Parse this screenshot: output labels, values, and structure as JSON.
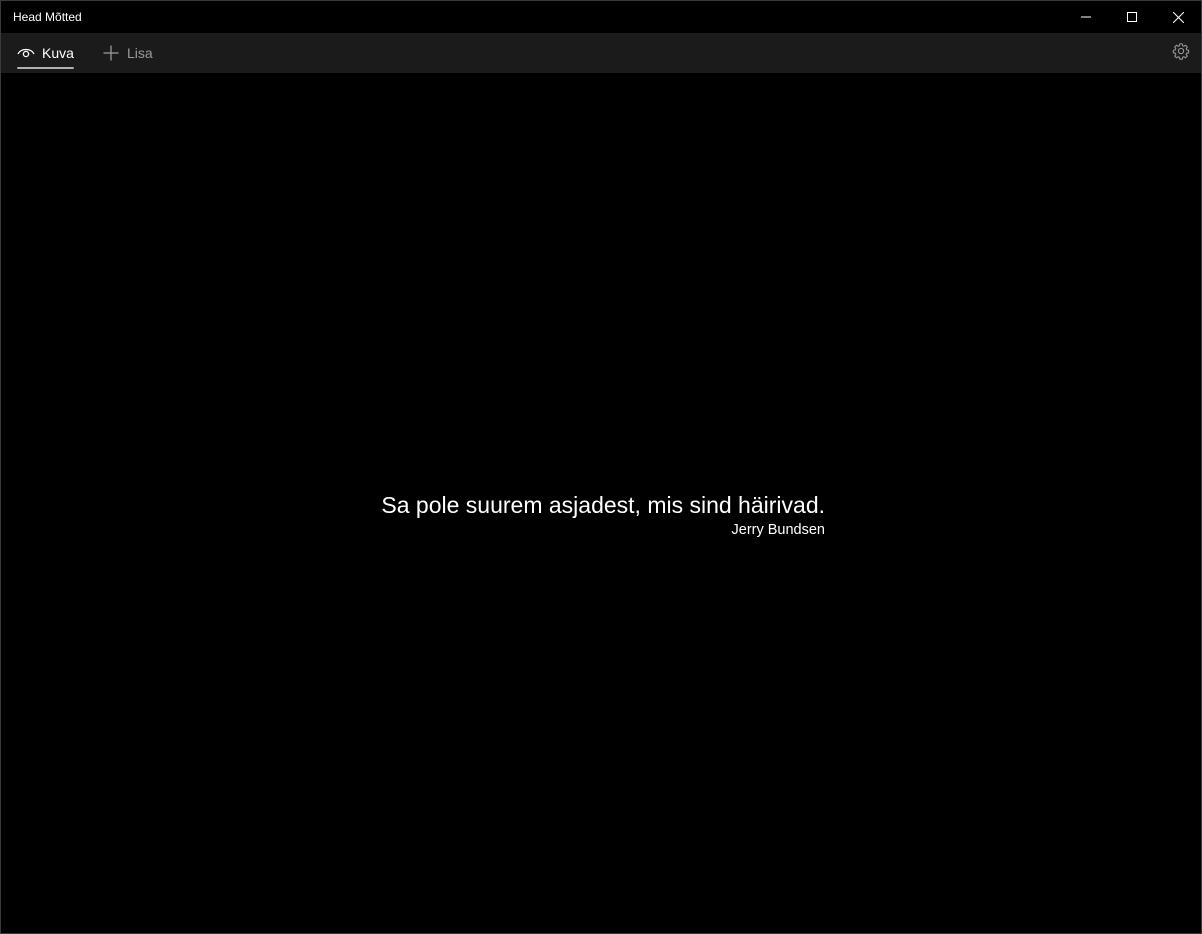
{
  "window": {
    "title": "Head Mõtted"
  },
  "caption": {
    "minimize_icon": "minimize-icon",
    "maximize_icon": "maximize-icon",
    "close_icon": "close-icon"
  },
  "nav": {
    "tabs": [
      {
        "label": "Kuva",
        "icon": "eye-icon",
        "selected": true
      },
      {
        "label": "Lisa",
        "icon": "plus-icon",
        "selected": false
      }
    ],
    "settings_icon": "gear-icon"
  },
  "quote": {
    "text": "Sa pole suurem asjadest, mis sind häirivad.",
    "author": "Jerry Bundsen"
  },
  "colors": {
    "background": "#000000",
    "navbar": "#1b1b1b",
    "text": "#ffffff",
    "inactive_tab": "#9a9a9a"
  }
}
